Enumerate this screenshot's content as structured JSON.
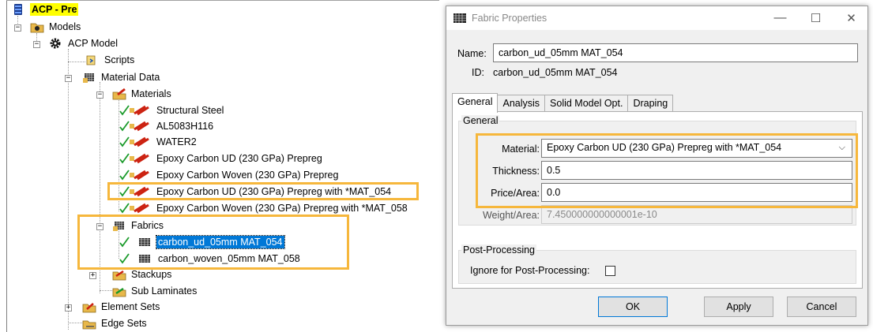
{
  "tree": {
    "root": "ACP - Pre",
    "models": "Models",
    "acp_model": "ACP Model",
    "scripts": "Scripts",
    "material_data": "Material Data",
    "materials": "Materials",
    "material_items": [
      "Structural Steel",
      "AL5083H116",
      "WATER2",
      "Epoxy Carbon UD (230 GPa) Prepreg",
      "Epoxy Carbon Woven (230 GPa) Prepreg",
      "Epoxy Carbon UD (230 GPa) Prepreg with *MAT_054",
      "Epoxy Carbon Woven (230 GPa) Prepreg with *MAT_058"
    ],
    "fabrics": "Fabrics",
    "fabric_items": [
      "carbon_ud_05mm MAT_054",
      "carbon_woven_05mm MAT_058"
    ],
    "stackups": "Stackups",
    "sub_laminates": "Sub Laminates",
    "element_sets": "Element Sets",
    "edge_sets": "Edge Sets"
  },
  "dialog": {
    "title": "Fabric Properties",
    "name_label": "Name:",
    "name_value": "carbon_ud_05mm MAT_054",
    "id_label": "ID:",
    "id_value": "carbon_ud_05mm MAT_054",
    "tabs": [
      "General",
      "Analysis",
      "Solid Model Opt.",
      "Draping"
    ],
    "general_group": "General",
    "material_label": "Material:",
    "material_value": "Epoxy Carbon UD (230 GPa) Prepreg with *MAT_054",
    "thickness_label": "Thickness:",
    "thickness_value": "0.5",
    "price_label": "Price/Area:",
    "price_value": "0.0",
    "weight_label": "Weight/Area:",
    "weight_value": "7.450000000000001e-10",
    "post_group": "Post-Processing",
    "ignore_label": "Ignore for Post-Processing:",
    "ignore_checked": false,
    "buttons": {
      "ok": "OK",
      "apply": "Apply",
      "cancel": "Cancel"
    },
    "window_controls": {
      "minimize": "—",
      "maximize": "☐",
      "close": "✕"
    }
  },
  "colors": {
    "highlight": "#f6b73c",
    "selection": "#0078d7",
    "root_bg": "#ffff00"
  }
}
